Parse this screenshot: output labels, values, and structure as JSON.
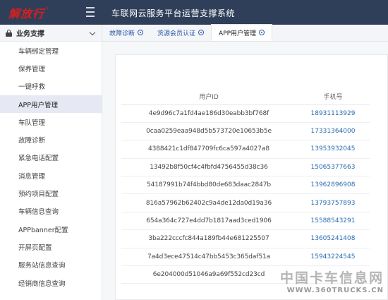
{
  "header": {
    "logo_text": "解放行",
    "title": "车联网云服务平台运营支撑系统"
  },
  "sidebar": {
    "group_label": "业务支撑",
    "items": [
      {
        "label": "车辆绑定管理"
      },
      {
        "label": "保养管理"
      },
      {
        "label": "一键呼救"
      },
      {
        "label": "APP用户管理"
      },
      {
        "label": "车队管理"
      },
      {
        "label": "故障诊断"
      },
      {
        "label": "紧急电话配置"
      },
      {
        "label": "消息管理"
      },
      {
        "label": "预约项目配置"
      },
      {
        "label": "车辆信息查询"
      },
      {
        "label": "APPbanner配置"
      },
      {
        "label": "开屏页配置"
      },
      {
        "label": "服务站信息查询"
      },
      {
        "label": "经销商信息查询"
      }
    ],
    "active_index": 3
  },
  "tabs": [
    {
      "label": "故障诊断"
    },
    {
      "label": "货源会员认证"
    },
    {
      "label": "APP用户管理"
    }
  ],
  "active_tab": 2,
  "table": {
    "columns": [
      "用户ID",
      "手机号"
    ],
    "rows": [
      {
        "uid": "4e9d96c7a1fd4ae186d30eabb3bf768f",
        "phone": "18931113929"
      },
      {
        "uid": "0caa0259eaa948d5b573720e10653b5e",
        "phone": "17331364000"
      },
      {
        "uid": "4388421c1df847709fc6ca597a4027a8",
        "phone": "13953932045"
      },
      {
        "uid": "13492b8f50cf4c4fbfd4756455d38c36",
        "phone": "15065377663"
      },
      {
        "uid": "54187991b74f4bbd80de683daac2847b",
        "phone": "13962896908"
      },
      {
        "uid": "816a57962b62402c9a4de12da0d19a36",
        "phone": "13793757893"
      },
      {
        "uid": "654a364c727e4dd7b1817aad3ced1906",
        "phone": "15588543291"
      },
      {
        "uid": "3ba222cccfc844a189fb44e681225507",
        "phone": "13605241408"
      },
      {
        "uid": "7a4d3ece47514c47bb5453c365daf51a",
        "phone": "15943224545"
      },
      {
        "uid": "6e204000d51046a9a69f552cd23cd",
        "phone": ""
      }
    ]
  },
  "watermark": {
    "cn": "中国卡车信息网",
    "url": "WWW.360TRUCKS.CN"
  },
  "colors": {
    "topbar": "#2f3f5a",
    "logo": "#d81e1e",
    "link": "#2a6bb0",
    "active_bg": "#e6e9f4"
  }
}
